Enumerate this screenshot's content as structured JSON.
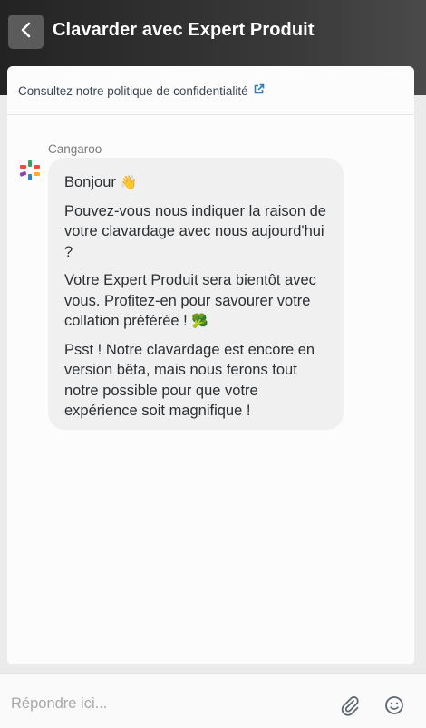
{
  "header": {
    "back_label": "back",
    "title": "Clavarder avec Expert Produit"
  },
  "privacy": {
    "text": "Consultez notre politique de confidentialité"
  },
  "message": {
    "sender": "Cangaroo",
    "paragraphs": [
      "Bonjour",
      "Pouvez-vous nous indiquer la raison de votre clavardage avec nous aujourd'hui ?",
      "Votre Expert Produit sera bientôt avec vous. Profitez-en pour savourer votre collation préférée !",
      "Psst ! Notre clavardage est encore en version bêta, mais nous ferons tout notre possible pour que votre expérience soit magnifique !"
    ],
    "emoji_wave": "👋",
    "emoji_broccoli": "🥦"
  },
  "composer": {
    "placeholder": "Répondre ici..."
  },
  "icons": {
    "back": "chevron-left-icon",
    "external": "external-link-icon",
    "attach": "paperclip-icon",
    "emoji": "smiley-icon"
  },
  "colors": {
    "header_bg": "#2e2e2e",
    "bubble_bg": "#f0f0f0",
    "link": "#3a4652"
  }
}
